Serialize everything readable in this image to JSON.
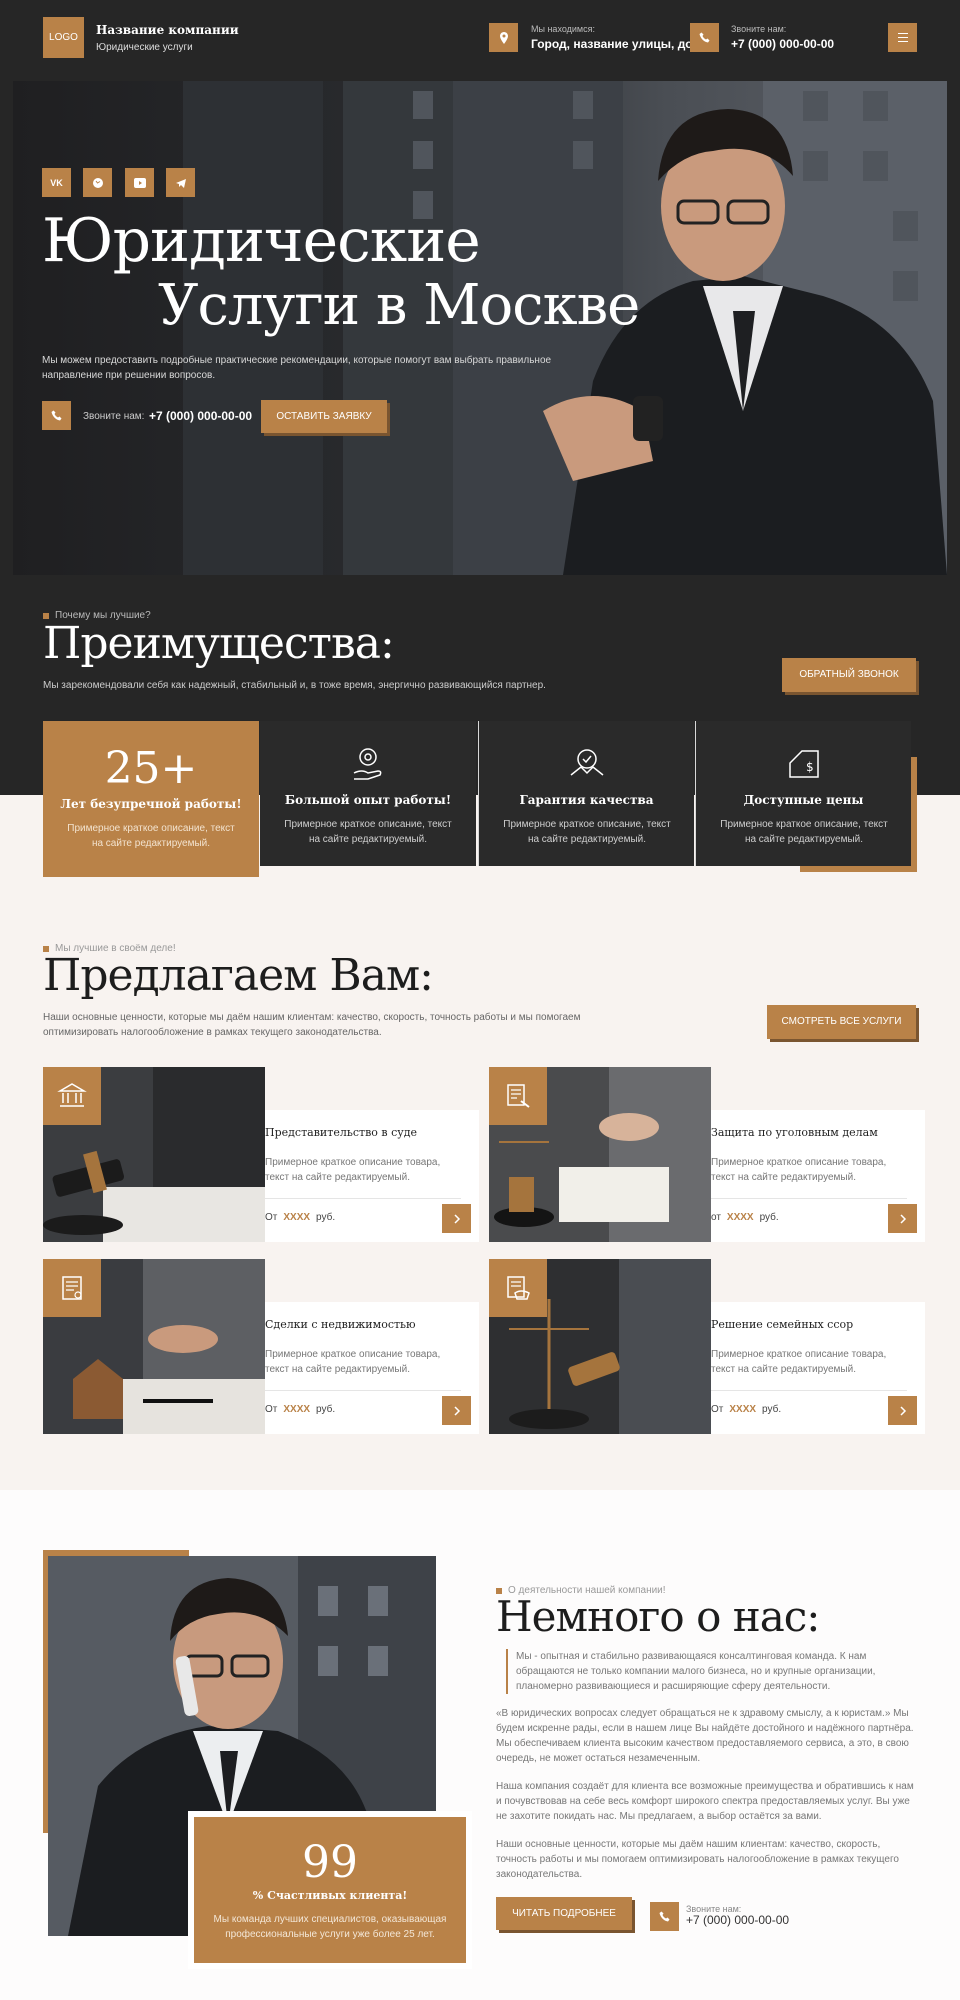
{
  "header": {
    "logo": "LOGO",
    "company_name": "Название компании",
    "company_sub": "Юридические услуги",
    "location_label": "Мы находимся:",
    "location_value": "Город, название улицы, дом",
    "phone_label": "Звоните нам:",
    "phone_value": "+7 (000) 000-00-00"
  },
  "hero": {
    "social": [
      "VK",
      "WA",
      "YT",
      "TG"
    ],
    "title_line1": "Юридические",
    "title_line2": "Услуги в Москве",
    "description": "Мы можем предоставить подробные практические рекомендации, которые помогут вам выбрать правильное направление при решении  вопросов.",
    "call_label": "Звоните нам:",
    "call_value": "+7 (000) 000-00-00",
    "cta": "ОСТАВИТЬ ЗАЯВКУ"
  },
  "advantages": {
    "kicker": "Почему мы лучшие?",
    "title": "Преимущества:",
    "description": "Мы зарекомендовали себя как надежный, стабильный и, в тоже время, энергично развивающийся партнер.",
    "callback": "ОБРАТНЫЙ ЗВОНОК",
    "cards": [
      {
        "big": "25+",
        "title": "Лет безупречной работы!",
        "text": "Примерное краткое описание, текст на сайте редактируемый."
      },
      {
        "icon": "gear-hand-icon",
        "title": "Большой опыт работы!",
        "text": "Примерное краткое описание, текст на сайте редактируемый."
      },
      {
        "icon": "quality-badge-icon",
        "title": "Гарантия качества",
        "text": "Примерное краткое описание, текст на сайте редактируемый."
      },
      {
        "icon": "price-tag-icon",
        "title": "Доступные цены",
        "text": "Примерное краткое описание, текст на сайте редактируемый."
      }
    ]
  },
  "services": {
    "kicker": "Мы лучшие в своём деле!",
    "title": "Предлагаем Вам:",
    "description": "Наши основные ценности, которые мы даём нашим клиентам: качество, скорость, точность работы и мы помогаем оптимизировать налогообложение в рамках текущего законодательства.",
    "all_button": "СМОТРЕТЬ ВСЕ УСЛУГИ",
    "items": [
      {
        "title": "Представительство в суде",
        "text": "Примерное краткое описание товара, текст на сайте редактируемый.",
        "price_from": "От",
        "price": "XXXX",
        "currency": "руб.",
        "icon": "courthouse-icon"
      },
      {
        "title": "Защита по уголовным делам",
        "text": "Примерное краткое описание товара, текст на сайте редактируемый.",
        "price_from": "от",
        "price": "XXXX",
        "currency": "руб.",
        "icon": "document-gavel-icon"
      },
      {
        "title": "Сделки с недвижимостью",
        "text": "Примерное краткое описание товара, текст на сайте редактируемый.",
        "price_from": "От",
        "price": "XXXX",
        "currency": "руб.",
        "icon": "contract-icon"
      },
      {
        "title": "Решение семейных ссор",
        "text": "Примерное краткое описание товара, текст на сайте редактируемый.",
        "price_from": "От",
        "price": "XXXX",
        "currency": "руб.",
        "icon": "handshake-document-icon"
      }
    ]
  },
  "about": {
    "kicker": "О деятельности нашей компании!",
    "title": "Немного о нас:",
    "p1": "Мы - опытная и стабильно развивающаяся консалтинговая команда. К нам обращаются не только компании малого бизнеса, но и крупные организации, планомерно развивающиеся и расширяющие сферу деятельности.",
    "p2": "«В юридических вопросах следует обращаться не к здравому смыслу, а к юристам.» Мы будем искренне рады, если в нашем лице Вы найдёте достойного и надёжного партнёра. Мы обеспечиваем клиента высоким качеством предоставляемого сервиса, а это, в свою очередь, не может остаться незамеченным.",
    "p3": "Наша компания создаёт для клиента все возможные преимущества и обратившись к нам и почувствовав на себе весь комфорт широкого спектра предоставляемых услуг. Вы уже не захотите покидать нас. Мы предлагаем, а выбор остаётся за вами.",
    "p4": "Наши основные ценности, которые мы даём нашим клиентам: качество, скорость, точность работы и мы помогаем оптимизировать налогообложение в рамках текущего законодательства.",
    "read_more": "ЧИТАТЬ ПОДРОБНЕЕ",
    "call_label": "Звоните нам:",
    "call_value": "+7 (000) 000-00-00",
    "stat_number": "99",
    "stat_label": "% Счастливых клиента!",
    "stat_text": "Мы команда лучших специалистов, оказывающая профессиональные услуги уже более 25 лет."
  }
}
